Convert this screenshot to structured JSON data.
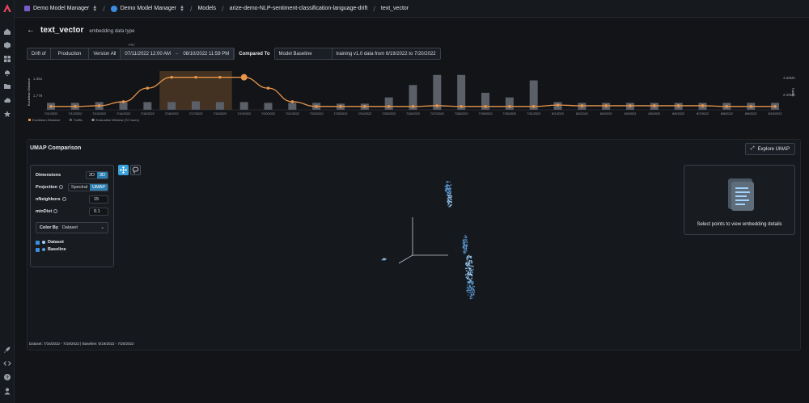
{
  "nav": {
    "rail_icons": [
      "home-icon",
      "cube-icon",
      "grid-icon",
      "bell-icon",
      "folder-icon",
      "cloud-icon",
      "star-icon"
    ],
    "rail_bottom_icons": [
      "rocket-icon",
      "code-icon",
      "help-icon",
      "user-icon"
    ]
  },
  "breadcrumb": {
    "space": "Demo Model Manager",
    "org": "Demo Model Manager",
    "models": "Models",
    "model": "arize-demo-NLP-sentiment-classification-language-drift",
    "feature": "text_vector"
  },
  "header": {
    "title": "text_vector",
    "subtitle": "embedding data type"
  },
  "filters": {
    "drift_of_label": "Drift of",
    "environment": "Production",
    "version": "Version All",
    "timezone": "PST",
    "start": "07/11/2022 12:00 AM",
    "range_sep": "–",
    "end": "08/10/2022 11:59 PM",
    "compared_to_label": "Compared To",
    "baseline": "Model Baseline",
    "baseline_desc": "training v1.0 data from 6/19/2022 to 7/20/2022"
  },
  "chart": {
    "y_left_label": "Euclidean Distance",
    "y_right_label": "Traffic",
    "left_ticks": [
      "1.351",
      "1.779"
    ],
    "right_ticks": [
      "4.56Ms",
      "2.26Ms"
    ],
    "legend": [
      "Euclidean Distance",
      "Traffic",
      "Evaluation Window (72 hours)"
    ]
  },
  "chart_data": {
    "type": "line",
    "categories": [
      "7/11/2022",
      "7/12/2022",
      "7/13/2022",
      "7/14/2022",
      "7/15/2022",
      "7/16/2022",
      "7/17/2022",
      "7/18/2022",
      "7/19/2022",
      "7/20/2022",
      "7/21/2022",
      "7/22/2022",
      "7/23/2022",
      "7/24/2022",
      "7/25/2022",
      "7/26/2022",
      "7/27/2022",
      "7/28/2022",
      "7/29/2022",
      "7/30/2022",
      "7/31/2022",
      "8/1/2022",
      "8/2/2022",
      "8/3/2022",
      "8/4/2022",
      "8/5/2022",
      "8/6/2022",
      "8/7/2022",
      "8/8/2022",
      "8/9/2022",
      "8/10/2022"
    ],
    "series": [
      {
        "name": "Euclidean Distance",
        "values": [
          1.35,
          1.35,
          1.36,
          1.42,
          1.62,
          1.78,
          1.78,
          1.78,
          1.78,
          1.62,
          1.42,
          1.35,
          1.35,
          1.35,
          1.35,
          1.35,
          1.36,
          1.35,
          1.35,
          1.35,
          1.35,
          1.37,
          1.36,
          1.36,
          1.36,
          1.36,
          1.36,
          1.36,
          1.35,
          1.35,
          1.35
        ]
      },
      {
        "name": "Traffic",
        "values": [
          0.9,
          0.9,
          1.0,
          1.0,
          1.0,
          1.0,
          1.1,
          1.0,
          1.0,
          0.9,
          0.9,
          0.9,
          0.8,
          0.8,
          1.6,
          3.2,
          4.5,
          4.5,
          2.2,
          1.6,
          3.8,
          1.0,
          0.9,
          0.9,
          0.9,
          0.9,
          0.9,
          0.9,
          0.9,
          0.9,
          0.9
        ]
      }
    ],
    "highlight_window": [
      "7/16/2022",
      "7/18/2022"
    ],
    "selected_point": "7/19/2022",
    "ylim": [
      1.3,
      1.8
    ],
    "colors": {
      "line": "#e8954a",
      "bars": "#5a5f68",
      "window": "#6b4a2b"
    }
  },
  "umap": {
    "title": "UMAP Comparison",
    "explore_button": "Explore UMAP",
    "dimensions_label": "Dimensions",
    "dim_2d": "2D",
    "dim_3d": "3D",
    "projection_label": "Projection",
    "proj_spectral": "Spectral",
    "proj_umap": "UMAP",
    "neighbors_label": "nNeighbors",
    "neighbors_value": "15",
    "mindist_label": "minDist",
    "mindist_value": "0.1",
    "color_by_label": "Color By",
    "color_by_value": "Dataset",
    "legend_dataset": "Dataset",
    "legend_baseline": "Baseline",
    "dataset_color": "#9fd2ff",
    "baseline_color": "#5b9bd5",
    "details_text": "Select points to view embedding details",
    "footer": "Dataset: 7/16/2022 - 7/19/2022 | Baseline: 6/19/2022 - 7/20/2022"
  }
}
